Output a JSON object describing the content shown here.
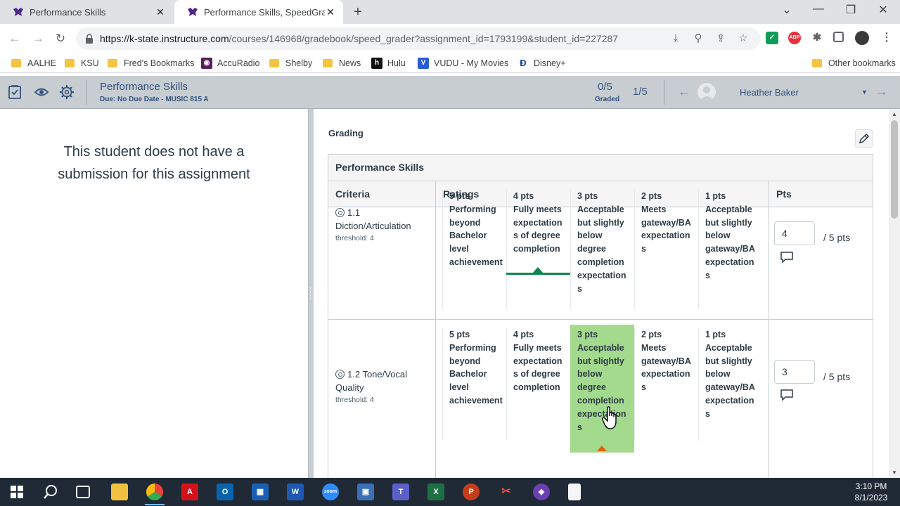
{
  "browser": {
    "tabs": [
      {
        "title": "Performance Skills",
        "active": false
      },
      {
        "title": "Performance Skills, SpeedGrader",
        "active": true
      }
    ],
    "url": {
      "host": "https://k-state.instructure.com",
      "path": "/courses/146968/gradebook/speed_grader?assignment_id=1793199&student_id=227287"
    },
    "bookmarks": [
      "AALHE",
      "KSU",
      "Fred's Bookmarks",
      "AccuRadio",
      "Shelby",
      "News",
      "Hulu",
      "VUDU - My Movies",
      "Disney+"
    ],
    "other_bookmarks": "Other bookmarks"
  },
  "header": {
    "assignment_title": "Performance Skills",
    "due_line": "Due: No Due Date - MUSIC 815 A",
    "graded_count": "0/5",
    "graded_label": "Graded",
    "position": "1/5",
    "student_name": "Heather Baker"
  },
  "left_pane": {
    "message": "This student does not have a submission for this assignment"
  },
  "grading": {
    "label": "Grading",
    "rubric_title": "Performance Skills",
    "col_criteria": "Criteria",
    "col_ratings": "Ratings",
    "col_pts": "Pts",
    "criteria": [
      {
        "name": "1.1 Diction/Articulation",
        "threshold": "threshold: 4",
        "score": "4",
        "out_of": "/ 5 pts",
        "selected_index": 1,
        "ratings": [
          {
            "pts": "5 pts",
            "desc": "Performing beyond Bachelor level achievement"
          },
          {
            "pts": "4 pts",
            "desc": "Fully meets expectation s of degree completion"
          },
          {
            "pts": "3 pts",
            "desc": "Acceptable but slightly below degree completion expectation s"
          },
          {
            "pts": "2 pts",
            "desc": "Meets gateway/BA expectation s"
          },
          {
            "pts": "1 pts",
            "desc": "Acceptable but slightly below gateway/BA expectation s"
          }
        ]
      },
      {
        "name": "1.2 Tone/Vocal Quality",
        "threshold": "threshold: 4",
        "score": "3",
        "out_of": "/ 5 pts",
        "selected_index": 2,
        "ratings": [
          {
            "pts": "5 pts",
            "desc": "Performing beyond Bachelor level achievement"
          },
          {
            "pts": "4 pts",
            "desc": "Fully meets expectation s of degree completion"
          },
          {
            "pts": "3 pts",
            "desc": "Acceptable but slightly below degree completion expectation s"
          },
          {
            "pts": "2 pts",
            "desc": "Meets gateway/BA expectation s"
          },
          {
            "pts": "1 pts",
            "desc": "Acceptable but slightly below gateway/BA expectation s"
          }
        ]
      }
    ]
  },
  "taskbar": {
    "time": "3:10 PM",
    "date": "8/1/2023"
  },
  "colors": {
    "selected_rating": "#a4da8e",
    "meets_threshold": "#0b874b",
    "below_threshold": "#e66000",
    "header_bg": "#c7cdd1"
  }
}
